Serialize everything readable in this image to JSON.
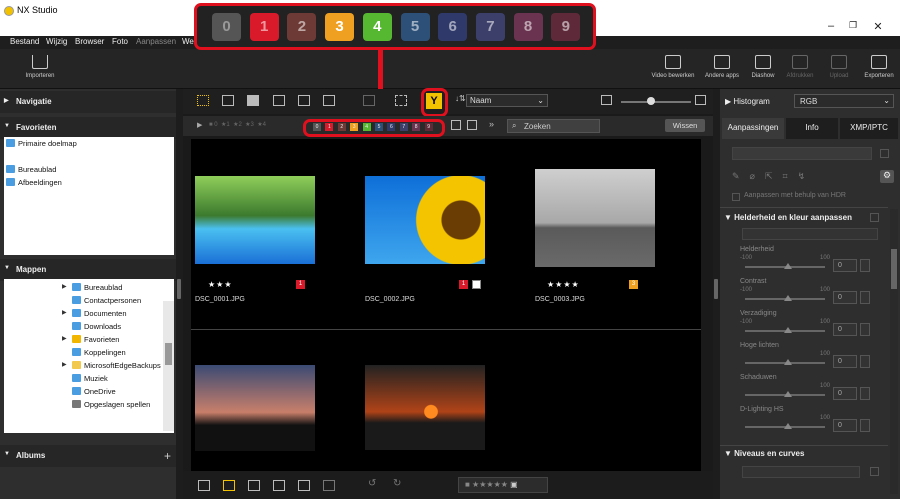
{
  "app": {
    "title": "NX Studio"
  },
  "menu": [
    "Bestand",
    "Wijzig",
    "Browser",
    "Foto",
    "Aanpassen",
    "We"
  ],
  "toolbar": {
    "import_label": "Importeren",
    "right_buttons": [
      "Video bewerken",
      "Andere apps",
      "Diashow",
      "Afdrukken",
      "Upload",
      "Exporteren"
    ]
  },
  "left": {
    "navigation": "Navigatie",
    "favorites": "Favorieten",
    "fav_items": [
      "Primaire doelmap",
      "Bureaublad",
      "Afbeeldingen"
    ],
    "folders": "Mappen",
    "folder_items": [
      "Bureaublad",
      "Contactpersonen",
      "Documenten",
      "Downloads",
      "Favorieten",
      "Koppelingen",
      "MicrosoftEdgeBackups",
      "Muziek",
      "OneDrive",
      "Opgeslagen spellen"
    ],
    "albums": "Albums"
  },
  "viewbar": {
    "sort_label": "Naam"
  },
  "filterbar": {
    "ratings": [
      "0",
      "1",
      "2",
      "3",
      "4",
      "5"
    ],
    "search_placeholder": "Zoeken",
    "clear_label": "Wissen"
  },
  "labels_popup": {
    "values": [
      "0",
      "1",
      "2",
      "3",
      "4",
      "5",
      "6",
      "7",
      "8",
      "9"
    ],
    "colors": [
      "#555555",
      "#d91a2a",
      "#6e3a35",
      "#f0a020",
      "#56b731",
      "#2d5078",
      "#2f3a6a",
      "#3c3f6a",
      "#6a3350",
      "#5e2a3a"
    ]
  },
  "photos": [
    {
      "name": "DSC_0001.JPG",
      "stars": "★★★",
      "label": "1"
    },
    {
      "name": "DSC_0002.JPG",
      "stars": "",
      "label": "1"
    },
    {
      "name": "DSC_0003.JPG",
      "stars": "★★★★",
      "label": "3"
    },
    {
      "name": "",
      "stars": "",
      "label": ""
    },
    {
      "name": "",
      "stars": "",
      "label": ""
    }
  ],
  "right": {
    "histogram_label": "Histogram",
    "histogram_mode": "RGB",
    "tabs": [
      "Aanpassingen",
      "Info",
      "XMP/IPTC"
    ],
    "hdr_label": "Aanpassen met behulp van HDR",
    "section_title": "Helderheid en kleur aanpassen",
    "sliders": [
      {
        "label": "Helderheid",
        "min": "-100",
        "max": "100",
        "value": "0"
      },
      {
        "label": "Contrast",
        "min": "-100",
        "max": "100",
        "value": "0"
      },
      {
        "label": "Verzadiging",
        "min": "-100",
        "max": "100",
        "value": "0"
      },
      {
        "label": "Hoge lichten",
        "min": "",
        "max": "100",
        "value": "0"
      },
      {
        "label": "Schaduwen",
        "min": "",
        "max": "100",
        "value": "0"
      },
      {
        "label": "D-Lighting HS",
        "min": "",
        "max": "100",
        "value": "0"
      }
    ],
    "curves_title": "Niveaus en curves"
  }
}
